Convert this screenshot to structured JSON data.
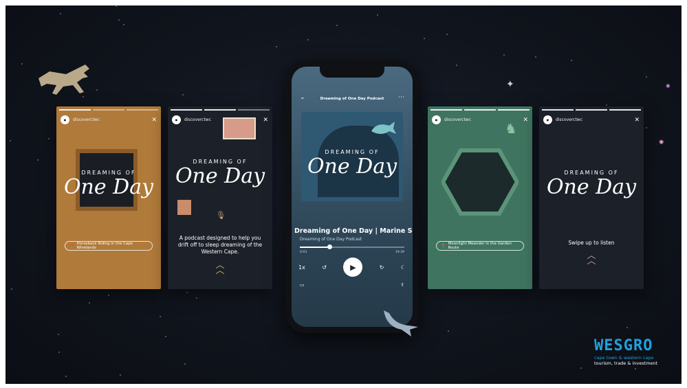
{
  "stories": [
    {
      "handle": "discoverctwc",
      "dreaming": "DREAMING OF",
      "oneday": "One Day",
      "location": "Horseback Riding in the Cape Winelands",
      "bg": "#b07a3a"
    },
    {
      "handle": "discoverctwc",
      "dreaming": "DREAMING OF",
      "oneday": "One Day",
      "description": "A podcast designed to help you drift off to sleep dreaming of the Western Cape.",
      "bg": "#1c2029"
    },
    {
      "handle": "discoverctwc",
      "dreaming": "DREAMING OF",
      "oneday": "One Day",
      "location": "Moonlight Meander in the Garden Route",
      "bg": "#3f7560"
    },
    {
      "handle": "discoverctwc",
      "dreaming": "DREAMING OF",
      "oneday": "One Day",
      "swipe": "Swipe up to listen",
      "bg": "#1c2029"
    }
  ],
  "player": {
    "header_title": "Dreaming of One Day Podcast",
    "art_dreaming": "DREAMING OF",
    "art_oneday": "One Day",
    "episode_title": "Dreaming of One Day | Marine Safa",
    "podcast_name": "Dreaming of One Day Podcast",
    "time_elapsed": "0:03",
    "time_remaining": "19:39",
    "progress": 0.28,
    "speed": "1x"
  },
  "brand": {
    "name": "WESGRO",
    "line1": "cape town & western cape",
    "line2": "tourism, trade & investment"
  },
  "colors": {
    "accent": "#1fa1e0",
    "chevron": "#d6b37a",
    "background": "#10141c"
  }
}
